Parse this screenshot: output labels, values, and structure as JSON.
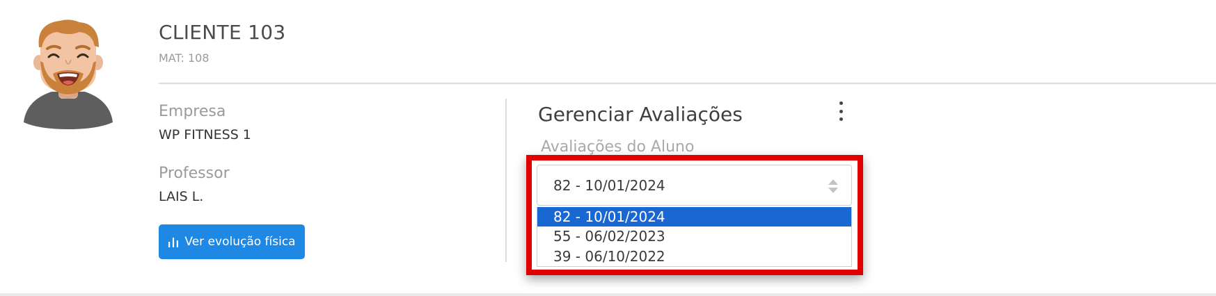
{
  "client": {
    "name": "CLIENTE 103",
    "mat": "MAT: 108"
  },
  "info": {
    "empresa_label": "Empresa",
    "empresa_value": "WP FITNESS 1",
    "professor_label": "Professor",
    "professor_value": "LAIS L."
  },
  "evolution_button": {
    "label": "Ver evolução física",
    "icon": "bar-chart-icon",
    "color": "#1e88e5"
  },
  "assessments": {
    "title": "Gerenciar Avaliações",
    "menu_icon": "kebab-menu-icon",
    "select_label": "Avaliações do Aluno",
    "selected_value": "82 - 10/01/2024",
    "options": [
      {
        "label": "82 - 10/01/2024",
        "selected": true
      },
      {
        "label": "55 - 06/02/2023",
        "selected": false
      },
      {
        "label": "39 - 06/10/2022",
        "selected": false
      }
    ],
    "highlight_color": "#e00000",
    "option_highlight_color": "#1967d2"
  }
}
